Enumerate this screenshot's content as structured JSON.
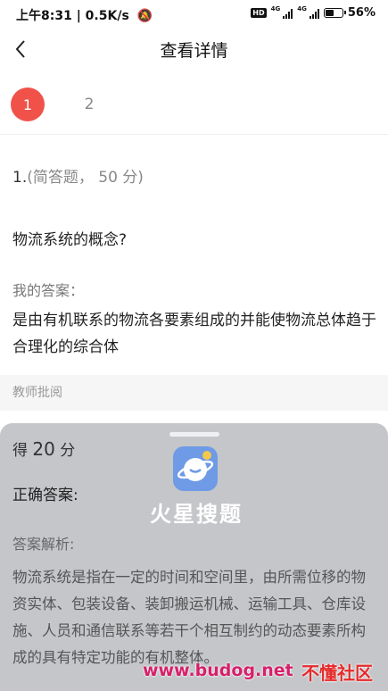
{
  "status_bar": {
    "time_speed": "上午8:31 | 0.5K/s",
    "hd": "HD",
    "net1": "4G",
    "net2": "4G",
    "battery_text": "56%",
    "battery_level": 0.56
  },
  "nav": {
    "title": "查看详情"
  },
  "tabs": [
    "1",
    "2"
  ],
  "question": {
    "number": "1.",
    "meta": "(简答题， 50 分)",
    "text": "物流系统的概念?"
  },
  "my_answer": {
    "label": "我的答案：",
    "text": "是由有机联系的物流各要素组成的并能使物流总体趋于合理化的综合体"
  },
  "teacher": {
    "label": "教师批阅"
  },
  "result": {
    "score_prefix": "得",
    "score_value": "20",
    "score_suffix": "分",
    "correct_label": "正确答案:",
    "analysis_label": "答案解析:",
    "analysis_text": "物流系统是指在一定的时间和空间里，由所需位移的物资实体、包装设备、装卸搬运机械、运输工具、仓库设施、人员和通信联系等若干个相互制约的动态要素所构成的具有特定功能的有机整体。"
  },
  "overlay_logo": {
    "text": "火星搜题"
  },
  "watermark": {
    "url": "www.budog.net",
    "name": "不懂社区"
  },
  "colors": {
    "accent": "#f0524a",
    "sheet": "#c4c6ca",
    "logo": "#6e9ae6"
  }
}
